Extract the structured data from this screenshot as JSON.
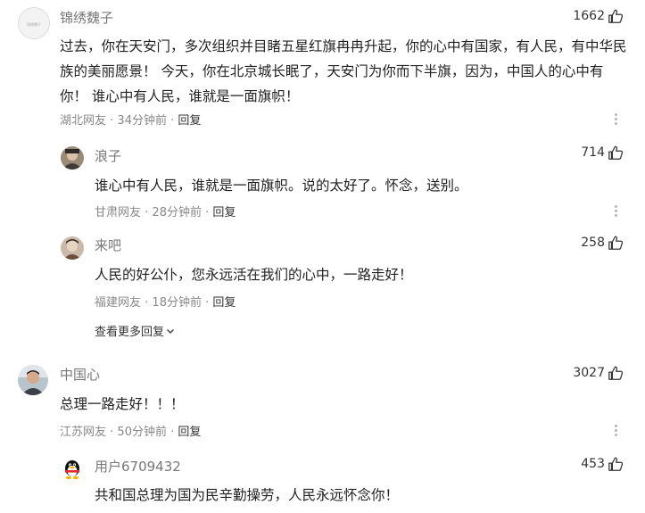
{
  "comments": [
    {
      "user": "锦绣魏子",
      "likes": "1662",
      "text": "过去，你在天安门，多次组织并目睹五星红旗冉冉升起，你的心中有国家，有人民，有中华民族的美丽愿景！ 今天，你在北京城长眠了，天安门为你而下半旗，因为，中国人的心中有你！ 谁心中有人民，谁就是一面旗帜！",
      "location": "湖北网友",
      "time": "34分钟前",
      "reply_label": "回复",
      "replies": [
        {
          "user": "浪子",
          "likes": "714",
          "text": "谁心中有人民，谁就是一面旗帜。说的太好了。怀念，送别。",
          "location": "甘肃网友",
          "time": "28分钟前",
          "reply_label": "回复"
        },
        {
          "user": "来吧",
          "likes": "258",
          "text": "人民的好公仆，您永远活在我们的心中，一路走好！",
          "location": "福建网友",
          "time": "18分钟前",
          "reply_label": "回复"
        }
      ],
      "view_more_label": "查看更多回复"
    },
    {
      "user": "中国心",
      "likes": "3027",
      "text": "总理一路走好！！！",
      "location": "江苏网友",
      "time": "50分钟前",
      "reply_label": "回复",
      "replies": [
        {
          "user": "用户6709432",
          "likes": "453",
          "text": "共和国总理为国为民辛勤操劳，人民永远怀念你！"
        }
      ]
    }
  ],
  "avatar_watermark": "锦绣魏子",
  "icons": {
    "like": "thumbs-up-icon",
    "more": "vertical-dots-icon",
    "expand": "chevron-down-icon"
  },
  "colors": {
    "username": "#777777",
    "meta": "#888888",
    "text": "#222222",
    "icon": "#b5b5b5"
  }
}
